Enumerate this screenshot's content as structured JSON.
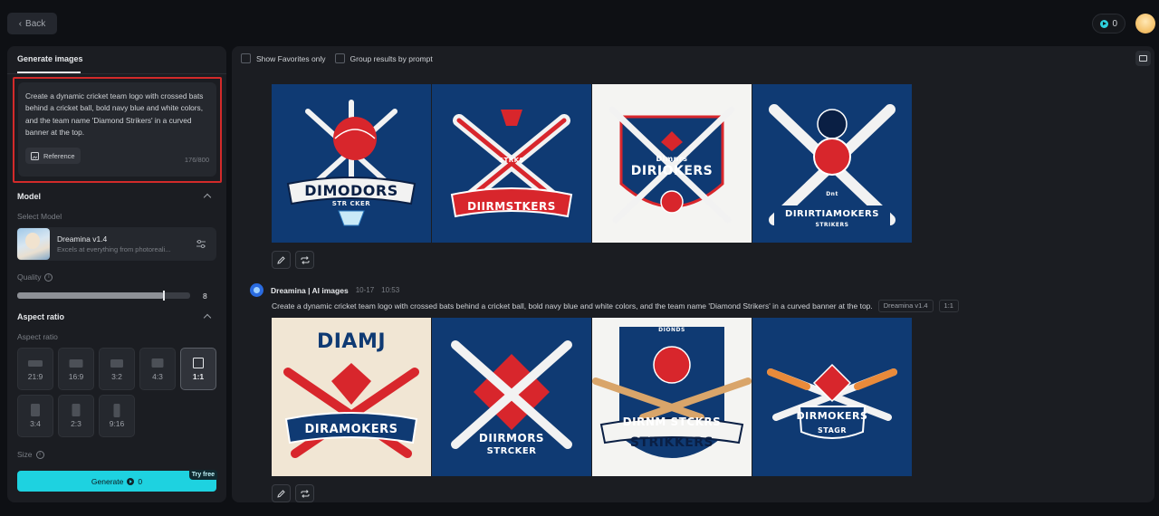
{
  "topbar": {
    "back_label": "Back",
    "credits": "0"
  },
  "left": {
    "tab_label": "Generate images",
    "prompt": "Create a dynamic cricket team logo with crossed bats behind a cricket ball, bold navy blue and white colors, and the team name 'Diamond Strikers' in a curved banner at the top.",
    "reference_label": "Reference",
    "counter": "176/800",
    "model_section": "Model",
    "select_model_label": "Select Model",
    "model_name": "Dreamina v1.4",
    "model_desc": "Excels at everything from photoreali...",
    "quality_label": "Quality",
    "quality_value": "8",
    "quality_fraction": 0.85,
    "aspect_section": "Aspect ratio",
    "aspect_label": "Aspect ratio",
    "ratios": [
      "21:9",
      "16:9",
      "3:2",
      "4:3",
      "1:1",
      "3:4",
      "2:3",
      "9:16"
    ],
    "selected_ratio": "1:1",
    "size_label": "Size",
    "generate_label": "Generate",
    "generate_cost": "0",
    "try_free": "Try free"
  },
  "right": {
    "show_favorites": "Show Favorites only",
    "group_by_prompt": "Group results by prompt",
    "group2": {
      "title": "Dreamina | AI images",
      "date": "10-17",
      "time": "10:53",
      "prompt": "Create a dynamic cricket team logo with crossed bats behind a cricket ball, bold navy blue and white colors, and the team name 'Diamond Strikers' in a curved banner at the top.",
      "model_tag": "Dreamina v1.4",
      "ratio_tag": "1:1"
    },
    "row1_texts": [
      "DIMODORS",
      "STR CKER",
      "DIIRMSTKERS",
      "STRKS",
      "DIRIOKERS",
      "Dimnrs",
      "DIRIRTIAMOKERS",
      "Dnt",
      "STRIKERS"
    ],
    "row2_texts": [
      "DIAMJ",
      "DIRAMOKERS",
      "DIIRMORS",
      "STRCKER",
      "DIRNM STCKRS",
      "STRIKKERS",
      "DIONDS",
      "DIRMOKERS",
      "STAGR"
    ]
  },
  "colors": {
    "accent": "#1ed2e0",
    "navy": "#0f3a73",
    "red": "#d8262c",
    "highlight_border": "#d32a2a"
  }
}
